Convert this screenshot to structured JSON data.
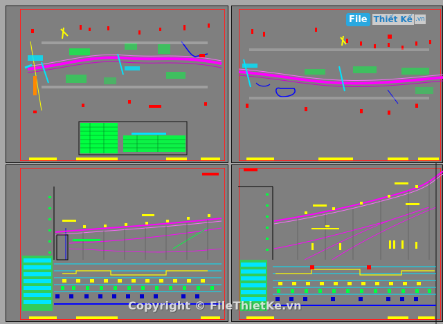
{
  "watermark": {
    "logo_box": "File",
    "logo_text": "Thiết Kế",
    "logo_tld": ".vn",
    "copyright": "Copyright © FileThietKe.vn"
  },
  "colors": {
    "sheet": "#7f7f7f",
    "frame": "#ff2020",
    "road": "#ff00ff",
    "cyan": "#00e5ff",
    "green": "#00ff40",
    "yellow": "#ffff00",
    "blue": "#0000ff",
    "red": "#ff0000"
  },
  "icons": [
    "cad-plan-view-left",
    "cad-plan-view-right",
    "cad-profile-left",
    "cad-profile-right"
  ]
}
